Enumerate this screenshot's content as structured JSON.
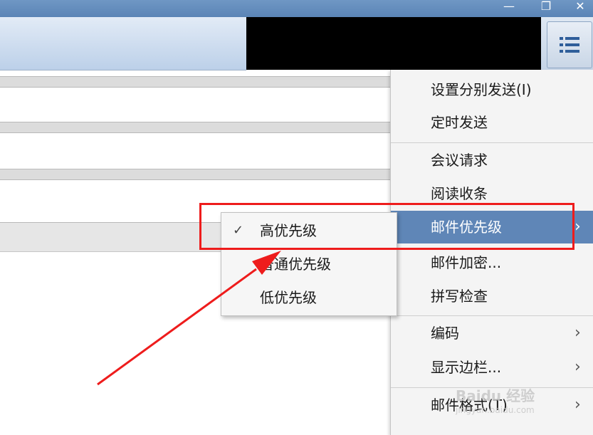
{
  "window": {
    "minimize_glyph": "—",
    "restore_glyph": "❐",
    "close_glyph": "✕"
  },
  "toolbar": {
    "menu_icon": "list-menu-icon"
  },
  "menu": {
    "items": [
      {
        "label": "设置分别发送(I)"
      },
      {
        "label": "定时发送"
      },
      {
        "label": "会议请求"
      },
      {
        "label": "阅读收条"
      },
      {
        "label": "邮件优先级",
        "arrow": "›"
      },
      {
        "label": "邮件加密..."
      },
      {
        "label": "拼写检查"
      },
      {
        "label": "编码",
        "arrow": "›"
      },
      {
        "label": "显示边栏...",
        "arrow": "›"
      },
      {
        "label": "邮件格式(T)",
        "arrow": "›"
      }
    ]
  },
  "submenu": {
    "items": [
      {
        "label": "高优先级",
        "check": "✓"
      },
      {
        "label": "普通优先级"
      },
      {
        "label": "低优先级"
      }
    ]
  },
  "watermark": {
    "text": "Baidu 经验",
    "url": "jingyan.baidu.com"
  },
  "colors": {
    "accent": "#5f86b7",
    "annotation": "#ee1c1c"
  }
}
